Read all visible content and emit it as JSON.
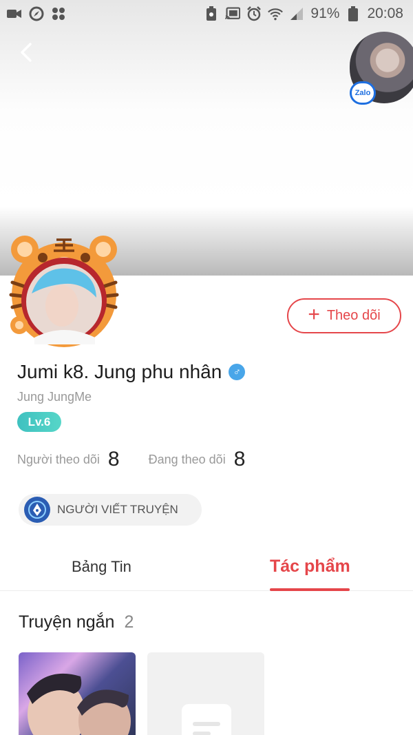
{
  "status_bar": {
    "battery": "91%",
    "time": "20:08",
    "left_icons": [
      "video-icon",
      "compass-icon",
      "apps-icon"
    ],
    "right_icons": [
      "recycle-icon",
      "cast-icon",
      "alarm-icon",
      "wifi-icon",
      "signal-icon",
      "battery-icon"
    ]
  },
  "header": {
    "zalo_badge": "Zalo"
  },
  "profile": {
    "name": "Jumi k8. Jung phu nhân",
    "gender_symbol": "♂",
    "username": "Jung JungMe",
    "level": "Lv.6",
    "follow_button": "Theo dõi",
    "stats": [
      {
        "label": "Người theo dõi",
        "value": "8"
      },
      {
        "label": "Đang theo dõi",
        "value": "8"
      }
    ],
    "role_badge": "NGƯỜI VIẾT TRUYỆN"
  },
  "tabs": [
    {
      "label": "Bảng Tin",
      "active": false
    },
    {
      "label": "Tác phẩm",
      "active": true
    }
  ],
  "section": {
    "title": "Truyện ngắn",
    "count": "2"
  },
  "colors": {
    "accent": "#e5464a",
    "level_badge": "#3fc1c0",
    "gender": "#49a6e9",
    "zalo": "#1e6fe0"
  }
}
